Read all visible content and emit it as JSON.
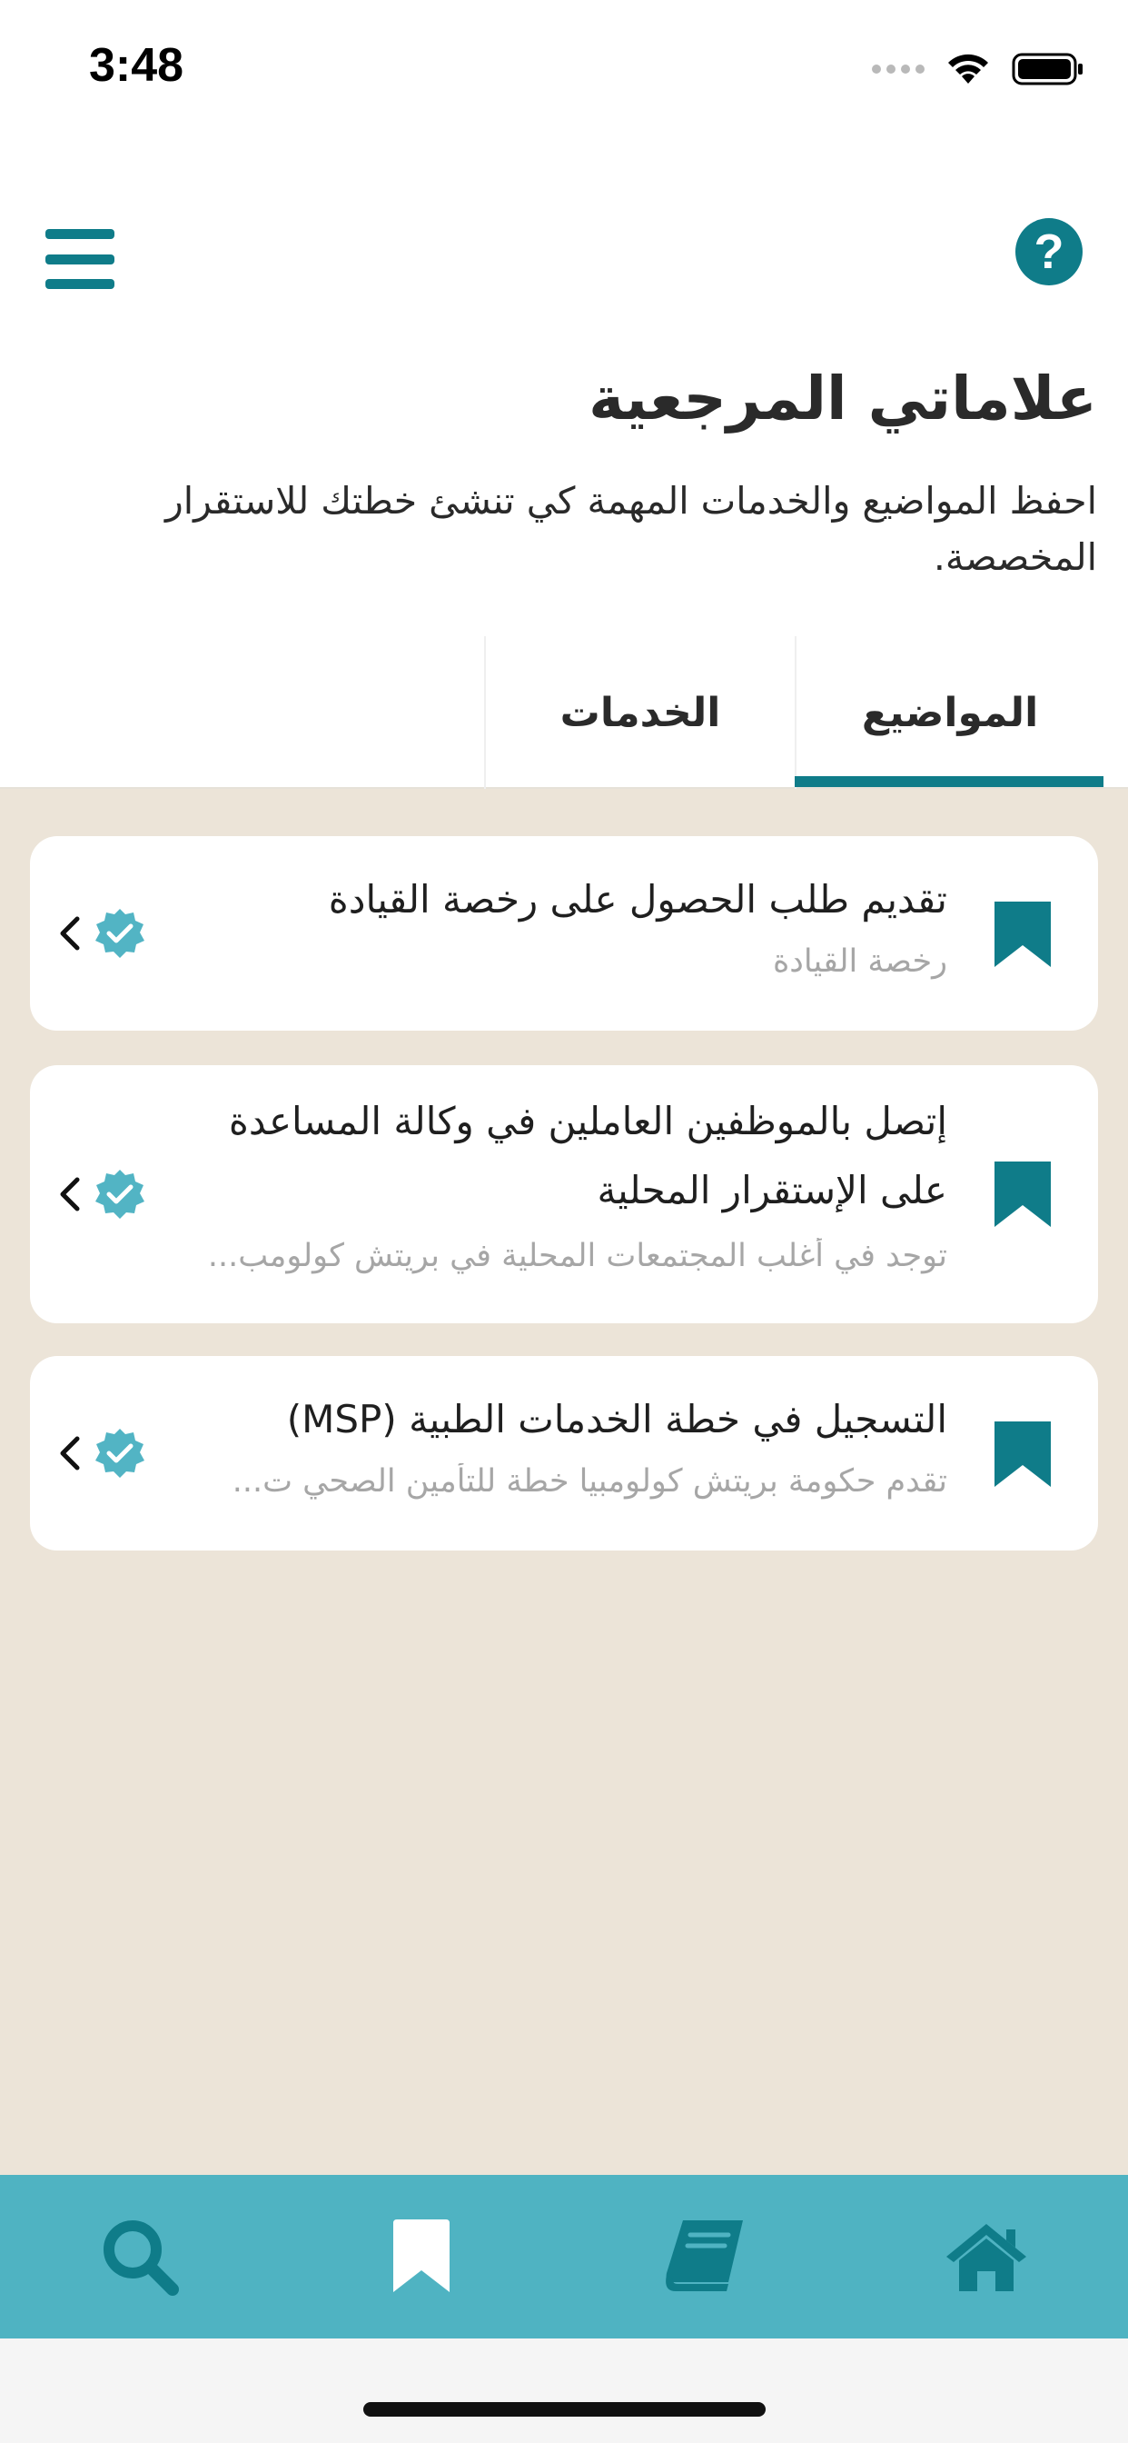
{
  "status_bar": {
    "time": "3:48"
  },
  "header": {
    "help_label": "?"
  },
  "page": {
    "title": "علاماتي المرجعية",
    "subtitle": "احفظ المواضيع والخدمات المهمة كي تنشئ خطتك للاستقرار المخصصة."
  },
  "tabs": [
    {
      "label": "المواضيع",
      "selected": true
    },
    {
      "label": "الخدمات",
      "selected": false
    }
  ],
  "cards": [
    {
      "title": "تقديم طلب الحصول على رخصة القيادة",
      "subtitle": "رخصة القيادة"
    },
    {
      "title": "إتصل بالموظفين العاملين في وكالة المساعدة على الإستقرار المحلية",
      "subtitle": "توجد في أغلب المجتمعات المحلية في بريتش كولومب..."
    },
    {
      "title": "التسجيل في خطة الخدمات الطبية (MSP)",
      "subtitle": "تقدم حكومة بريتش كولومبيا خطة للتأمين الصحي ت..."
    }
  ],
  "bottom_nav": {
    "items": [
      {
        "icon": "search-icon",
        "active": false
      },
      {
        "icon": "bookmark-icon",
        "active": true
      },
      {
        "icon": "book-icon",
        "active": false
      },
      {
        "icon": "home-icon",
        "active": false
      }
    ]
  },
  "colors": {
    "accent": "#0f7c89",
    "nav_background": "#4fb3c2",
    "content_background": "#ece4d8",
    "verified": "#52b4c4"
  }
}
